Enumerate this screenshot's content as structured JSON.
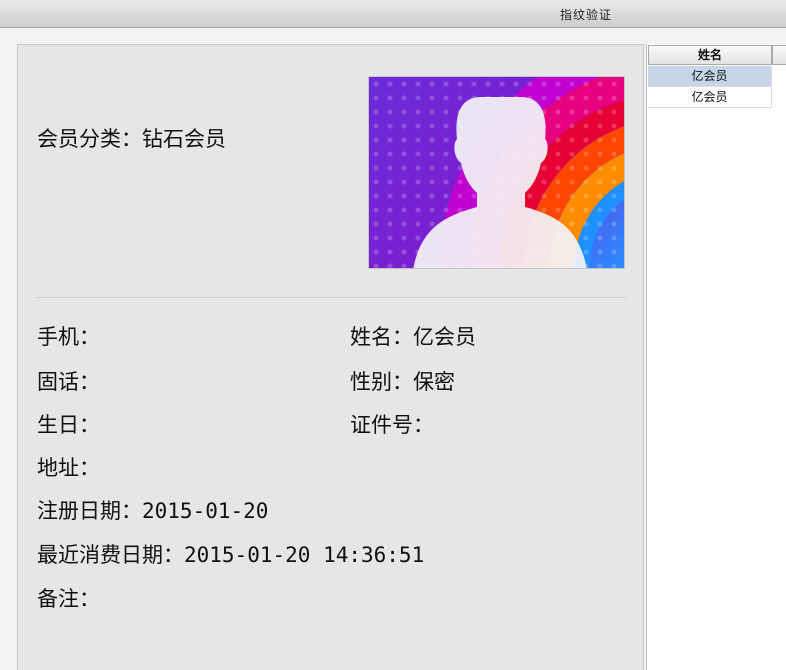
{
  "window": {
    "title": "指纹验证"
  },
  "member": {
    "category_label": "会员分类：",
    "category_value": "钻石会员",
    "mobile_label": "手机：",
    "mobile_value": "",
    "name_label": "姓名：",
    "name_value": "亿会员",
    "phone_label": "固话：",
    "phone_value": "",
    "gender_label": "性别：",
    "gender_value": "保密",
    "birthday_label": "生日：",
    "birthday_value": "",
    "id_label": "证件号：",
    "id_value": "",
    "address_label": "地址：",
    "address_value": "",
    "register_label": "注册日期：",
    "register_value": "2015-01-20",
    "last_spend_label": "最近消费日期：",
    "last_spend_value": "2015-01-20 14:36:51",
    "remark_label": "备注：",
    "remark_value": ""
  },
  "photo": {
    "icon": "avatar-placeholder-icon"
  },
  "grid": {
    "column_header": "姓名",
    "rows": [
      {
        "name": "亿会员",
        "selected": true
      },
      {
        "name": "亿会员",
        "selected": false
      }
    ]
  }
}
